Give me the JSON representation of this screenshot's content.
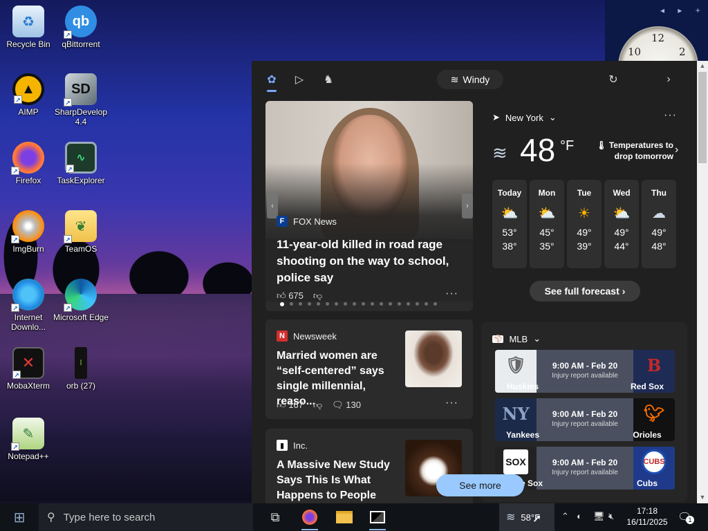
{
  "desktop": {
    "icons": [
      {
        "label": "Recycle Bin"
      },
      {
        "label": "qBittorrent"
      },
      {
        "label": "AIMP"
      },
      {
        "label": "SharpDevelop 4.4"
      },
      {
        "label": "Firefox"
      },
      {
        "label": "TaskExplorer"
      },
      {
        "label": "ImgBurn"
      },
      {
        "label": "TeamOS"
      },
      {
        "label": "Internet Downlo..."
      },
      {
        "label": "Microsoft Edge"
      },
      {
        "label": "MobaXterm"
      },
      {
        "label": "orb (27)"
      },
      {
        "label": "Notepad++"
      }
    ],
    "clock_numbers": [
      "10",
      "12",
      "2"
    ]
  },
  "panel": {
    "weather_pill": "Windy",
    "hero": {
      "source": "FOX News",
      "headline": "11-year-old killed in road rage shooting on the way to school, police say",
      "likes": "675"
    },
    "story2": {
      "source": "Newsweek",
      "headline": "Married women are “self-centered” says single millennial, reaso...",
      "likes": "167",
      "comments": "130"
    },
    "story3": {
      "source": "Inc.",
      "headline": "A Massive New Study Says This Is What Happens to People Wh..."
    },
    "weather": {
      "location": "New York",
      "temp": "48",
      "unit": "°F",
      "note": "Temperatures to drop tomorrow",
      "forecast": [
        {
          "day": "Today",
          "hi": "53°",
          "lo": "38°",
          "icon": "partly-sunny-icon"
        },
        {
          "day": "Mon",
          "hi": "45°",
          "lo": "35°",
          "icon": "partly-sunny-icon"
        },
        {
          "day": "Tue",
          "hi": "49°",
          "lo": "39°",
          "icon": "sunny-icon"
        },
        {
          "day": "Wed",
          "hi": "49°",
          "lo": "44°",
          "icon": "partly-sunny-icon"
        },
        {
          "day": "Thu",
          "hi": "49°",
          "lo": "48°",
          "icon": "cloudy-icon"
        }
      ],
      "forecast_button": "See full forecast"
    },
    "mlb": {
      "title": "MLB",
      "games": [
        {
          "time": "9:00 AM - Feb 20",
          "note": "Injury report available",
          "home": "Huskies",
          "away": "Red Sox"
        },
        {
          "time": "9:00 AM - Feb 20",
          "note": "Injury report available",
          "home": "Yankees",
          "away": "Orioles"
        },
        {
          "time": "9:00 AM - Feb 20",
          "note": "Injury report available",
          "home": "White Sox",
          "away": "Cubs"
        }
      ]
    },
    "see_more": "See more"
  },
  "taskbar": {
    "search_placeholder": "Type here to search",
    "weather_temp": "58°F",
    "time": "17:18",
    "date": "16/11/2025",
    "notification_count": "1"
  },
  "colors": {
    "panel_bg": "#202020",
    "card_bg": "#2b2b2b",
    "see_more_bg": "#99c9ff",
    "taskbar_bg": "#101318"
  }
}
